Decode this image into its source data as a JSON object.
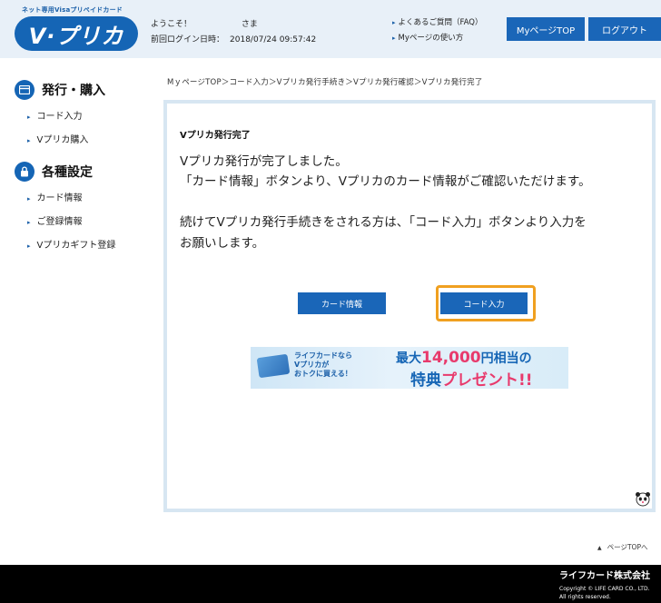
{
  "header": {
    "logo_tagline": "ネット専用Visaプリペイドカード",
    "logo_text": "V·プリカ",
    "welcome_label": "ようこそ！",
    "welcome_suffix": "さま",
    "last_login_label": "前回ログイン日時：",
    "last_login_value": "2018/07/24 09:57:42",
    "links": [
      "よくあるご質問（FAQ）",
      "Myページの使い方"
    ],
    "mypage_button": "MyページTOP",
    "logout_button": "ログアウト"
  },
  "sidebar": {
    "sections": [
      {
        "title": "発行・購入",
        "icon": "card-icon",
        "items": [
          "コード入力",
          "Vプリカ購入"
        ]
      },
      {
        "title": "各種設定",
        "icon": "lock-icon",
        "items": [
          "カード情報",
          "ご登録情報",
          "Vプリカギフト登録"
        ]
      }
    ]
  },
  "breadcrumb": "MｙページTOP＞コード入力＞Vプリカ発行手続き＞Vプリカ発行確認＞Vプリカ発行完了",
  "main": {
    "title": "Vプリカ発行完了",
    "messages": [
      "Vプリカ発行が完了しました。",
      "「カード情報」ボタンより、Vプリカのカード情報がご確認いただけます。",
      "続けてVプリカ発行手続きをされる方は、「コード入力」ボタンより入力を",
      "お願いします。"
    ],
    "card_info_button": "カード情報",
    "code_input_button": "コード入力"
  },
  "banner": {
    "left_text": [
      "ライフカードなら",
      "Vプリカが",
      "おトクに買える！"
    ],
    "line1_prefix": "最大",
    "line1_amount": "14,000",
    "line1_suffix": "円相当の",
    "line2_prefix": "特典",
    "line2_suffix": "プレゼント!!"
  },
  "page_top_link": "ページTOPへ",
  "footer": {
    "company": "ライフカード株式会社",
    "copyright": [
      "Copyright © LIFE CARD CO., LTD.",
      "All rights reserved."
    ]
  },
  "colors": {
    "brand_blue": "#1a66b8",
    "focus_orange": "#f0a020",
    "header_bg": "#e8f0f8"
  }
}
